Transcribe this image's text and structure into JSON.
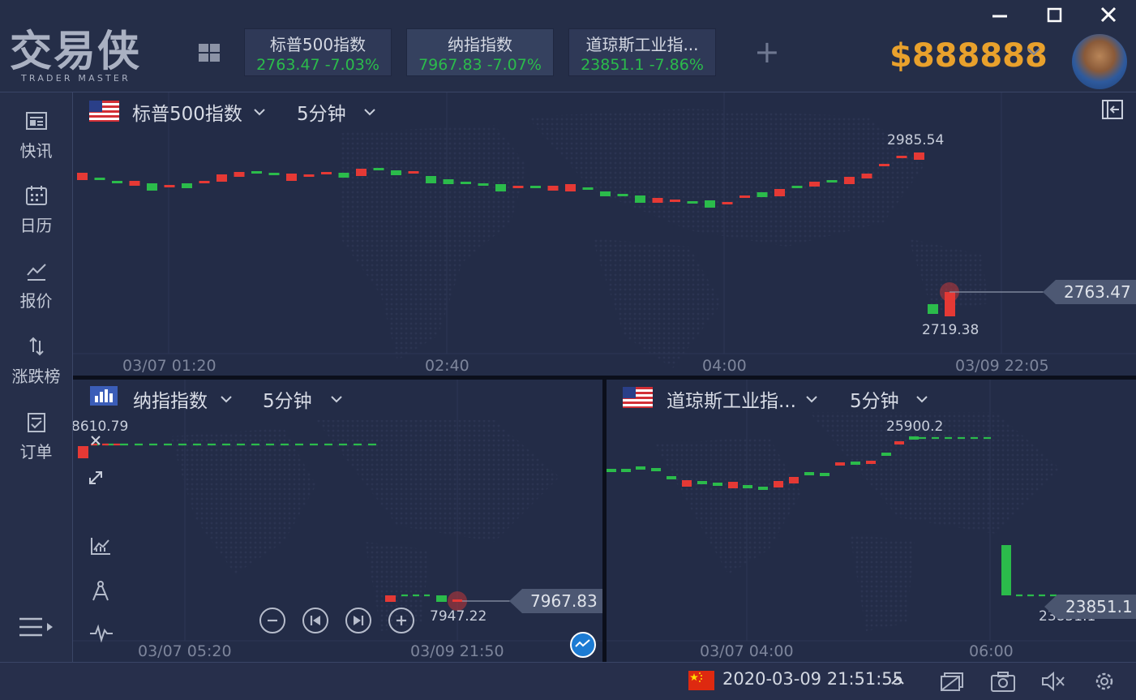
{
  "app": {
    "logo": "交易侠",
    "logo_sub": "TRADER MASTER"
  },
  "tickers": [
    {
      "name": "标普500指数",
      "value": "2763.47  -7.03%",
      "active": false
    },
    {
      "name": "纳指指数",
      "value": "7967.83  -7.07%",
      "active": true
    },
    {
      "name": "道琼斯工业指...",
      "value": "23851.1  -7.86%",
      "active": false
    }
  ],
  "balance": "$888888",
  "sidebar": [
    {
      "label": "快讯",
      "icon": "news-icon"
    },
    {
      "label": "日历",
      "icon": "calendar-icon"
    },
    {
      "label": "报价",
      "icon": "quote-icon"
    },
    {
      "label": "涨跌榜",
      "icon": "ranking-icon"
    },
    {
      "label": "订单",
      "icon": "order-icon"
    }
  ],
  "charts": {
    "main": {
      "symbol": "标普500指数",
      "period": "5分钟",
      "high_label": "2985.54",
      "low_label": "2719.38",
      "last_price": "2763.47",
      "x_ticks": [
        "03/07 01:20",
        "02:40",
        "04:00",
        "03/09 22:05"
      ]
    },
    "nasdaq": {
      "symbol": "纳指指数",
      "period": "5分钟",
      "high_label": "8610.79",
      "low_label": "7947.22",
      "last_price": "7967.83",
      "x_ticks": [
        "03/07 05:20",
        "03/09 21:50"
      ]
    },
    "dow": {
      "symbol": "道琼斯工业指...",
      "period": "5分钟",
      "high_label": "25900.2",
      "low_label": "23851.1",
      "last_price": "23851.1",
      "x_ticks": [
        "03/07 04:00",
        "06:00"
      ]
    }
  },
  "status": {
    "datetime": "2020-03-09 21:51:55"
  },
  "colors": {
    "up": "#e53935",
    "down": "#2bbb4b",
    "accent": "#e9a12c",
    "bg": "#232c47"
  }
}
